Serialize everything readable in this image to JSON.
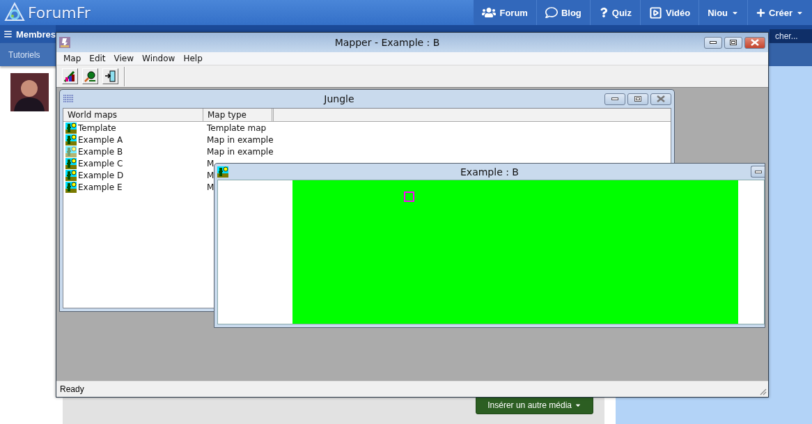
{
  "site": {
    "logo": "ForumFr",
    "nav": [
      {
        "label": "Forum",
        "kind": "users",
        "caret": false
      },
      {
        "label": "Blog",
        "kind": "bubble",
        "caret": false
      },
      {
        "label": "Quiz",
        "kind": "question",
        "caret": false
      },
      {
        "label": "Vidéo",
        "kind": "play",
        "caret": false
      },
      {
        "label": "Niou",
        "kind": "plain",
        "caret": true
      },
      {
        "label": "Créer",
        "kind": "plus",
        "caret": true
      }
    ],
    "members_tab": "Membres",
    "tutorials_tab": "Tutoriels",
    "search": {
      "placeholder": "cher..."
    },
    "media_button": "Insérer un autre média"
  },
  "app": {
    "title": "Mapper - Example : B",
    "menu": [
      "Map",
      "Edit",
      "View",
      "Window",
      "Help"
    ],
    "toolbar": [
      {
        "kind": "chart"
      },
      {
        "kind": "search"
      },
      {
        "kind": "exit"
      }
    ],
    "jungle": {
      "title": "Jungle",
      "columns": [
        "World maps",
        "Map type"
      ],
      "rows": [
        {
          "name": "Template",
          "type": "Template map",
          "selected": false
        },
        {
          "name": "Example A",
          "type": "Map in example",
          "selected": false
        },
        {
          "name": "Example B",
          "type": "Map in example",
          "selected": true
        },
        {
          "name": "Example C",
          "type": "M",
          "selected": false
        },
        {
          "name": "Example D",
          "type": "M",
          "selected": false
        },
        {
          "name": "Example E",
          "type": "M",
          "selected": false
        }
      ]
    },
    "map_window": {
      "title": "Example : B"
    },
    "status": "Ready"
  }
}
